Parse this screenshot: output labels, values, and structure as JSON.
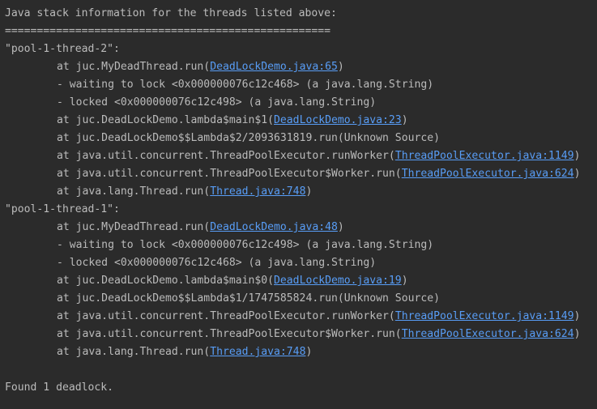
{
  "console": {
    "lines": [
      {
        "indent": false,
        "parts": [
          {
            "t": "Java stack information for the threads listed above:"
          }
        ]
      },
      {
        "indent": false,
        "parts": [
          {
            "t": "==================================================="
          }
        ]
      },
      {
        "indent": false,
        "parts": [
          {
            "t": "\"pool-1-thread-2\":"
          }
        ]
      },
      {
        "indent": true,
        "parts": [
          {
            "t": "at juc.MyDeadThread.run("
          },
          {
            "t": "DeadLockDemo.java:65",
            "link": true
          },
          {
            "t": ")"
          }
        ]
      },
      {
        "indent": true,
        "parts": [
          {
            "t": "- waiting to lock <0x000000076c12c468> (a java.lang.String)"
          }
        ]
      },
      {
        "indent": true,
        "parts": [
          {
            "t": "- locked <0x000000076c12c498> (a java.lang.String)"
          }
        ]
      },
      {
        "indent": true,
        "parts": [
          {
            "t": "at juc.DeadLockDemo.lambda$main$1("
          },
          {
            "t": "DeadLockDemo.java:23",
            "link": true
          },
          {
            "t": ")"
          }
        ]
      },
      {
        "indent": true,
        "parts": [
          {
            "t": "at juc.DeadLockDemo$$Lambda$2/2093631819.run(Unknown Source)"
          }
        ]
      },
      {
        "indent": true,
        "parts": [
          {
            "t": "at java.util.concurrent.ThreadPoolExecutor.runWorker("
          },
          {
            "t": "ThreadPoolExecutor.java:1149",
            "link": true
          },
          {
            "t": ")"
          }
        ]
      },
      {
        "indent": true,
        "parts": [
          {
            "t": "at java.util.concurrent.ThreadPoolExecutor$Worker.run("
          },
          {
            "t": "ThreadPoolExecutor.java:624",
            "link": true
          },
          {
            "t": ")"
          }
        ]
      },
      {
        "indent": true,
        "parts": [
          {
            "t": "at java.lang.Thread.run("
          },
          {
            "t": "Thread.java:748",
            "link": true
          },
          {
            "t": ")"
          }
        ]
      },
      {
        "indent": false,
        "parts": [
          {
            "t": "\"pool-1-thread-1\":"
          }
        ]
      },
      {
        "indent": true,
        "parts": [
          {
            "t": "at juc.MyDeadThread.run("
          },
          {
            "t": "DeadLockDemo.java:48",
            "link": true
          },
          {
            "t": ")"
          }
        ]
      },
      {
        "indent": true,
        "parts": [
          {
            "t": "- waiting to lock <0x000000076c12c498> (a java.lang.String)"
          }
        ]
      },
      {
        "indent": true,
        "parts": [
          {
            "t": "- locked <0x000000076c12c468> (a java.lang.String)"
          }
        ]
      },
      {
        "indent": true,
        "parts": [
          {
            "t": "at juc.DeadLockDemo.lambda$main$0("
          },
          {
            "t": "DeadLockDemo.java:19",
            "link": true
          },
          {
            "t": ")"
          }
        ]
      },
      {
        "indent": true,
        "parts": [
          {
            "t": "at juc.DeadLockDemo$$Lambda$1/1747585824.run(Unknown Source)"
          }
        ]
      },
      {
        "indent": true,
        "parts": [
          {
            "t": "at java.util.concurrent.ThreadPoolExecutor.runWorker("
          },
          {
            "t": "ThreadPoolExecutor.java:1149",
            "link": true
          },
          {
            "t": ")"
          }
        ]
      },
      {
        "indent": true,
        "parts": [
          {
            "t": "at java.util.concurrent.ThreadPoolExecutor$Worker.run("
          },
          {
            "t": "ThreadPoolExecutor.java:624",
            "link": true
          },
          {
            "t": ")"
          }
        ]
      },
      {
        "indent": true,
        "parts": [
          {
            "t": "at java.lang.Thread.run("
          },
          {
            "t": "Thread.java:748",
            "link": true
          },
          {
            "t": ")"
          }
        ]
      },
      {
        "indent": false,
        "parts": []
      },
      {
        "indent": false,
        "parts": [
          {
            "t": "Found 1 deadlock."
          }
        ]
      }
    ]
  },
  "colors": {
    "background": "#2b2b2b",
    "text": "#bbbbbb",
    "link": "#589df6"
  }
}
